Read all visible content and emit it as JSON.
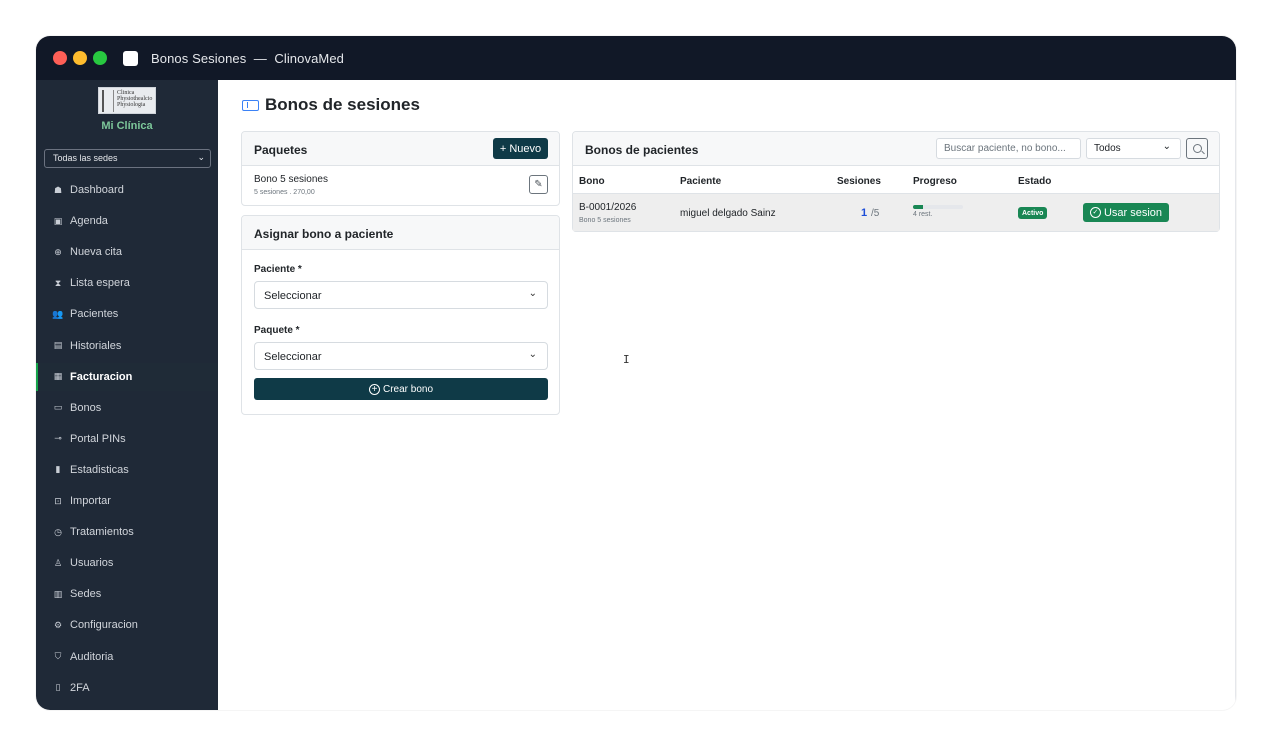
{
  "window": {
    "title": "Bonos Sesiones",
    "separator": "—",
    "app": "ClinovaMed"
  },
  "sidebar": {
    "logo_text": [
      "Clinica",
      "Physiothealcio",
      "Physiologia"
    ],
    "clinic_name": "Mi Clínica",
    "sede_select": "Todas las sedes",
    "items": [
      {
        "label": "Dashboard",
        "icon": "home-icon",
        "glyph": "☗"
      },
      {
        "label": "Agenda",
        "icon": "calendar-icon",
        "glyph": "▣"
      },
      {
        "label": "Nueva cita",
        "icon": "plus-circle-icon",
        "glyph": "⊕"
      },
      {
        "label": "Lista espera",
        "icon": "hourglass-icon",
        "glyph": "⧗"
      },
      {
        "label": "Pacientes",
        "icon": "people-icon",
        "glyph": "👥"
      },
      {
        "label": "Historiales",
        "icon": "file-icon",
        "glyph": "▤"
      },
      {
        "label": "Facturacion",
        "icon": "receipt-icon",
        "glyph": "▦"
      },
      {
        "label": "Bonos",
        "icon": "ticket-icon",
        "glyph": "▭"
      },
      {
        "label": "Portal PINs",
        "icon": "key-icon",
        "glyph": "⊸"
      },
      {
        "label": "Estadisticas",
        "icon": "bar-chart-icon",
        "glyph": "▮"
      },
      {
        "label": "Importar",
        "icon": "file-import-icon",
        "glyph": "⊡"
      },
      {
        "label": "Tratamientos",
        "icon": "clock-icon",
        "glyph": "◷"
      },
      {
        "label": "Usuarios",
        "icon": "user-gear-icon",
        "glyph": "♙"
      },
      {
        "label": "Sedes",
        "icon": "building-icon",
        "glyph": "▥"
      },
      {
        "label": "Configuracion",
        "icon": "gear-icon",
        "glyph": "⚙"
      },
      {
        "label": "Auditoria",
        "icon": "shield-icon",
        "glyph": "⛉"
      },
      {
        "label": "2FA",
        "icon": "phone-icon",
        "glyph": "▯"
      }
    ],
    "active_index": 6
  },
  "page": {
    "title": "Bonos de sesiones"
  },
  "packages": {
    "title": "Paquetes",
    "new_button": "+ Nuevo",
    "items": [
      {
        "name": "Bono 5 sesiones",
        "detail": "5 sesiones . 270,00"
      }
    ]
  },
  "assign": {
    "title": "Asignar bono a paciente",
    "patient_label": "Paciente *",
    "patient_value": "Seleccionar",
    "package_label": "Paquete *",
    "package_value": "Seleccionar",
    "create_button": "Crear bono"
  },
  "patient_bonos": {
    "title": "Bonos de pacientes",
    "search_placeholder": "Buscar paciente, no bono...",
    "filter_value": "Todos",
    "columns": [
      "Bono",
      "Paciente",
      "Sesiones",
      "Progreso",
      "Estado"
    ],
    "rows": [
      {
        "bono": "B-0001/2026",
        "bono_package": "Bono 5 sesiones",
        "patient": "miguel delgado Sainz",
        "sessions_used": "1",
        "sessions_total": "/5",
        "progress_fraction": 0.2,
        "remaining": "4 rest.",
        "status": "Activo",
        "action": "Usar sesion"
      }
    ]
  },
  "colors": {
    "sidebar": "#1f2937",
    "titlebar": "#111827",
    "primary": "#0f3a47",
    "success": "#198754",
    "accent": "#3b82f6"
  }
}
